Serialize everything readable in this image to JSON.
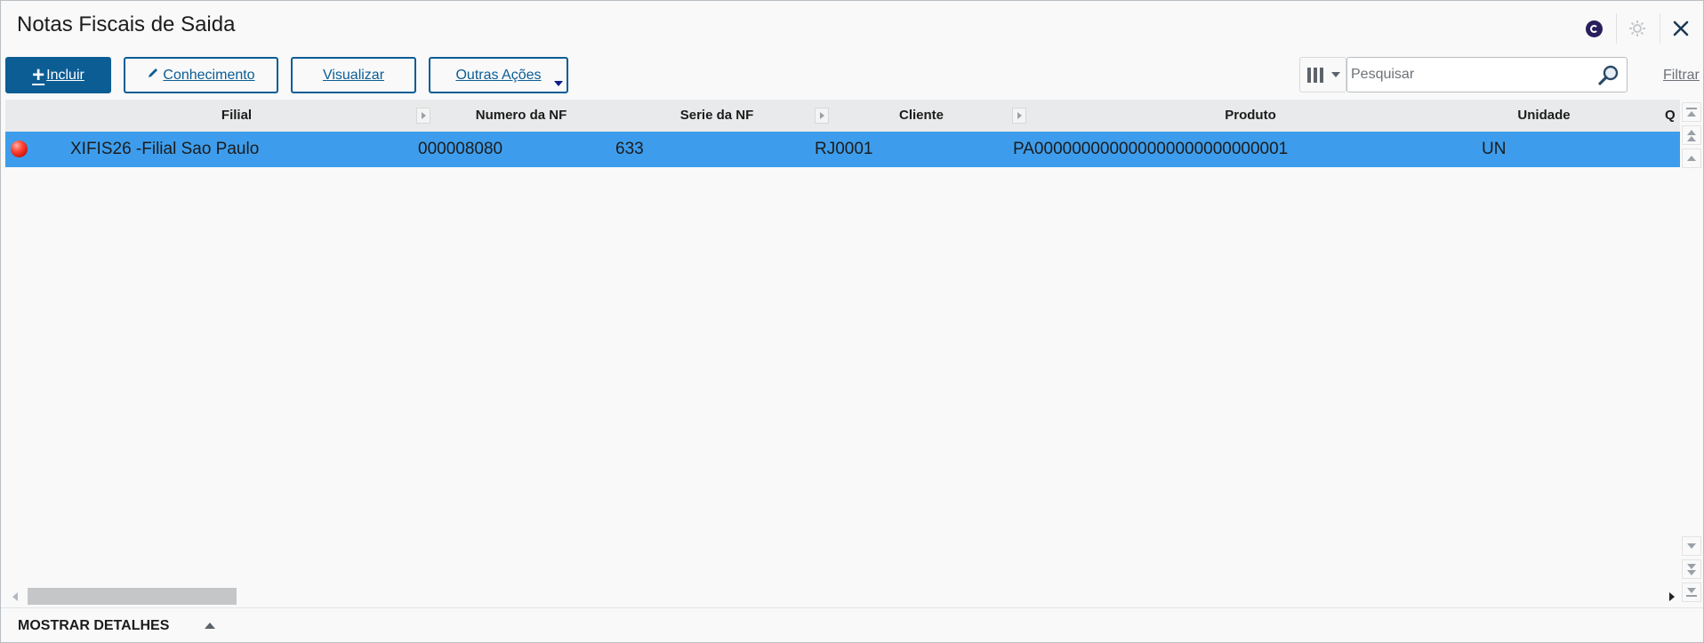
{
  "window": {
    "title": "Notas Fiscais de Saida"
  },
  "title_icons": [
    "brand-icon",
    "gear-icon",
    "close-icon"
  ],
  "toolbar": {
    "incluir_label": "Incluir",
    "conhecimento_label": "Conhecimento",
    "visualizar_label": "Visualizar",
    "outras_acoes_label": "Outras Ações"
  },
  "search": {
    "placeholder": "Pesquisar",
    "value": ""
  },
  "filter": {
    "label": "Filtrar"
  },
  "grid": {
    "columns": [
      "Filial",
      "Numero da NF",
      "Serie da NF",
      "Cliente",
      "Produto",
      "Unidade",
      "Q"
    ],
    "rows": [
      {
        "status": "red",
        "filial": "XIFIS26 -Filial Sao Paulo",
        "numero_nf": "000008080",
        "serie_nf": "633",
        "cliente": "RJ0001",
        "produto": "PA000000000000000000000000001",
        "unidade": "UN",
        "selected": true
      }
    ]
  },
  "footer": {
    "details_label": "MOSTRAR DETALHES"
  },
  "colors": {
    "primary": "#0c5d94",
    "selected_row": "#3d9dec",
    "header_bg": "#e9eaeb",
    "status_red": "#e0281b"
  }
}
